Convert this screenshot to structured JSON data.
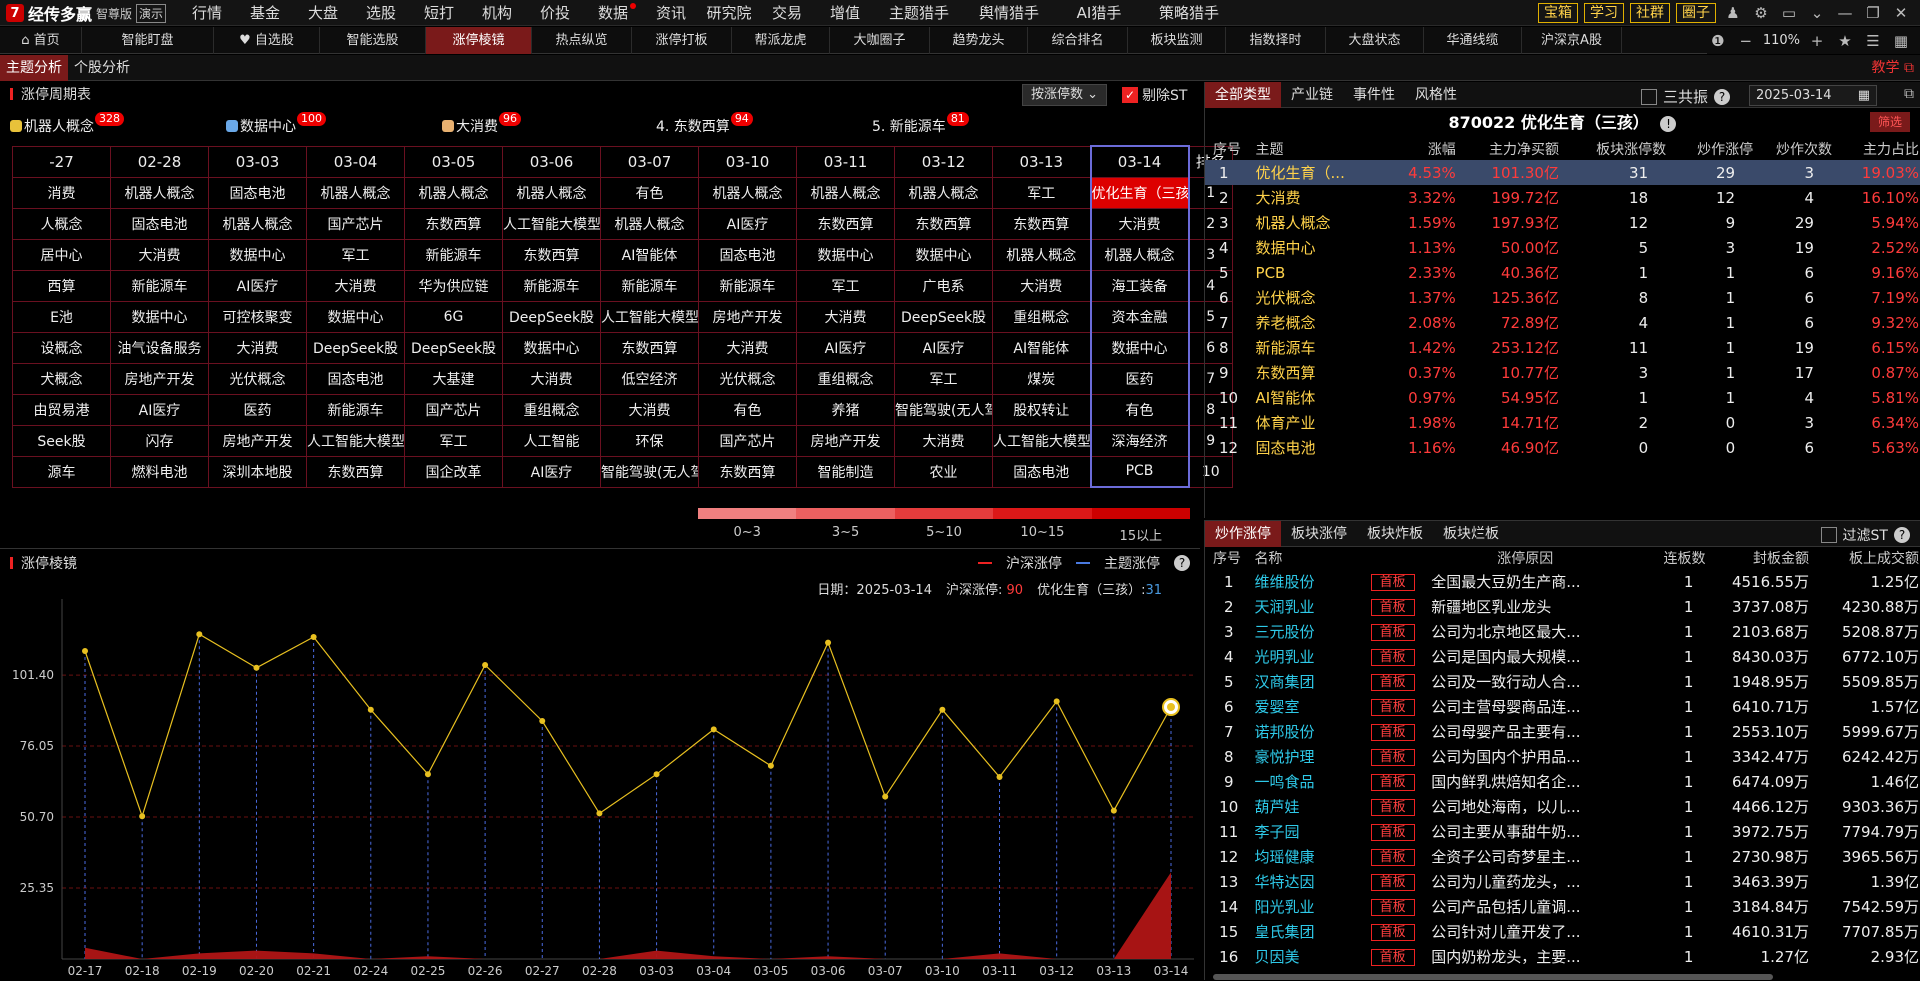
{
  "app": {
    "logo_mark": "7",
    "name": "经传多赢",
    "edition": "智尊版",
    "demo": "演示"
  },
  "top_menu": [
    {
      "label": "行情"
    },
    {
      "label": "基金"
    },
    {
      "label": "大盘"
    },
    {
      "label": "选股"
    },
    {
      "label": "短打"
    },
    {
      "label": "机构"
    },
    {
      "label": "价投"
    },
    {
      "label": "数据",
      "dot": true
    },
    {
      "label": "资讯"
    },
    {
      "label": "研究院"
    },
    {
      "label": "交易"
    },
    {
      "label": "增值"
    },
    {
      "label": "主题猎手",
      "wide": true
    },
    {
      "label": "舆情猎手",
      "wide": true
    },
    {
      "label": "AI猎手",
      "wide": true
    },
    {
      "label": "策略猎手",
      "wide": true
    }
  ],
  "top_right": {
    "buttons": [
      "宝箱",
      "学习",
      "社群",
      "圈子"
    ]
  },
  "tabs": [
    {
      "label": "⌂ 首页",
      "w": 82
    },
    {
      "label": "智能盯盘",
      "w": 132
    },
    {
      "label": "♥ 自选股",
      "w": 106
    },
    {
      "label": "智能选股",
      "w": 106
    },
    {
      "label": "涨停棱镜",
      "w": 106,
      "active": true
    },
    {
      "label": "热点纵览",
      "w": 100
    },
    {
      "label": "涨停打板",
      "w": 100
    },
    {
      "label": "帮派龙虎",
      "w": 98
    },
    {
      "label": "大咖圈子",
      "w": 100
    },
    {
      "label": "趋势龙头",
      "w": 98
    },
    {
      "label": "综合排名",
      "w": 100
    },
    {
      "label": "板块监测",
      "w": 98
    },
    {
      "label": "指数择时",
      "w": 100
    },
    {
      "label": "大盘状态",
      "w": 98
    },
    {
      "label": "华通线缆",
      "w": 98
    },
    {
      "label": "沪深京A股",
      "w": 100
    }
  ],
  "zoom": "110%",
  "sub_tabs": [
    {
      "label": "主题分析",
      "active": true
    },
    {
      "label": "个股分析"
    }
  ],
  "teach": "教学",
  "cycle": {
    "title": "涨停周期表",
    "sort_label": "按涨停数 ⌄",
    "exclude_st": "剔除ST",
    "legend": [
      {
        "label": "机器人概念",
        "count": "328",
        "color": "#e8c23a",
        "x": 0
      },
      {
        "label": "数据中心",
        "count": "100",
        "color": "#6aa8e8",
        "x": 216
      },
      {
        "label": "大消费",
        "count": "96",
        "color": "#e8b070",
        "x": 432
      },
      {
        "label": "4. 东数西算",
        "count": "94",
        "x": 646
      },
      {
        "label": "5. 新能源车",
        "count": "81",
        "x": 862
      }
    ],
    "dates": [
      "-27",
      "02-28",
      "03-03",
      "03-04",
      "03-05",
      "03-06",
      "03-07",
      "03-10",
      "03-11",
      "03-12",
      "03-13",
      "03-14"
    ],
    "rank_header": "排名",
    "rows": [
      [
        "消费",
        "机器人概念",
        "固态电池",
        "机器人概念",
        "机器人概念",
        "机器人概念",
        "有色",
        "机器人概念",
        "机器人概念",
        "机器人概念",
        "军工",
        "优化生育（三孩）",
        "1"
      ],
      [
        "人概念",
        "固态电池",
        "机器人概念",
        "国产芯片",
        "东数西算",
        "人工智能大模型",
        "机器人概念",
        "AI医疗",
        "东数西算",
        "东数西算",
        "东数西算",
        "大消费",
        "2"
      ],
      [
        "居中心",
        "大消费",
        "数据中心",
        "军工",
        "新能源车",
        "东数西算",
        "AI智能体",
        "固态电池",
        "数据中心",
        "数据中心",
        "机器人概念",
        "机器人概念",
        "3"
      ],
      [
        "西算",
        "新能源车",
        "AI医疗",
        "大消费",
        "华为供应链",
        "新能源车",
        "新能源车",
        "新能源车",
        "军工",
        "广电系",
        "大消费",
        "海工装备",
        "4"
      ],
      [
        "E池",
        "数据中心",
        "可控核聚变",
        "数据中心",
        "6G",
        "DeepSeek股",
        "人工智能大模型",
        "房地产开发",
        "大消费",
        "DeepSeek股",
        "重组概念",
        "资本金融",
        "5"
      ],
      [
        "设概念",
        "油气设备服务",
        "大消费",
        "DeepSeek股",
        "DeepSeek股",
        "数据中心",
        "东数西算",
        "大消费",
        "AI医疗",
        "AI医疗",
        "AI智能体",
        "数据中心",
        "6"
      ],
      [
        "犬概念",
        "房地产开发",
        "光伏概念",
        "固态电池",
        "大基建",
        "大消费",
        "低空经济",
        "光伏概念",
        "重组概念",
        "军工",
        "煤炭",
        "医药",
        "7"
      ],
      [
        "由贸易港",
        "AI医疗",
        "医药",
        "新能源车",
        "国产芯片",
        "重组概念",
        "大消费",
        "有色",
        "养猪",
        "智能驾驶(无人驾驶)",
        "股权转让",
        "有色",
        "8"
      ],
      [
        "Seek股",
        "闪存",
        "房地产开发",
        "人工智能大模型",
        "军工",
        "人工智能",
        "环保",
        "国产芯片",
        "房地产开发",
        "大消费",
        "人工智能大模型",
        "深海经济",
        "9"
      ],
      [
        "源车",
        "燃料电池",
        "深圳本地股",
        "东数西算",
        "国企改革",
        "AI医疗",
        "智能驾驶(无人驾驶)",
        "东数西算",
        "智能制造",
        "农业",
        "固态电池",
        "PCB",
        "10"
      ]
    ],
    "heat_colors": [
      "#f08080",
      "#ec6060",
      "#e43c3c",
      "#dc1818",
      "#cc0000"
    ],
    "heat_labels": [
      "0~3",
      "3~5",
      "5~10",
      "10~15",
      "15以上"
    ]
  },
  "prism": {
    "title": "涨停棱镜",
    "legend_sh": "沪深涨停",
    "legend_theme": "主题涨停",
    "info": {
      "date_label": "日期：",
      "date": "2025-03-14",
      "sh_label": "沪深涨停:",
      "sh_value": "90",
      "theme_label": "优化生育（三孩）:",
      "theme_value": "31"
    }
  },
  "chart_data": {
    "type": "line",
    "x": [
      "02-17",
      "02-18",
      "02-19",
      "02-20",
      "02-21",
      "02-24",
      "02-25",
      "02-26",
      "02-27",
      "02-28",
      "03-03",
      "03-04",
      "03-05",
      "03-06",
      "03-07",
      "03-10",
      "03-11",
      "03-12",
      "03-13",
      "03-14"
    ],
    "yticks": [
      25.35,
      50.7,
      76.05,
      101.4
    ],
    "ylim": [
      0,
      125
    ],
    "series": [
      {
        "name": "沪深涨停",
        "type": "area",
        "values": [
          110,
          51,
          116,
          104,
          115,
          89,
          66,
          105,
          85,
          52,
          66,
          82,
          69,
          113,
          58,
          89,
          65,
          92,
          53,
          90
        ]
      },
      {
        "name": "主题涨停",
        "type": "area",
        "values": [
          4,
          0,
          2,
          3,
          2,
          0,
          1,
          0,
          0,
          0,
          3,
          1,
          0,
          1,
          0,
          0,
          2,
          0,
          0,
          31
        ]
      }
    ]
  },
  "right": {
    "tabs": [
      {
        "label": "全部类型",
        "active": true
      },
      {
        "label": "产业链"
      },
      {
        "label": "事件性"
      },
      {
        "label": "风格性"
      }
    ],
    "sangong": "三共振",
    "date": "2025-03-14",
    "stock_title": "870022 优化生育（三孩）",
    "filter": "筛选",
    "headers": [
      "序号",
      "主题",
      "涨幅",
      "主力净买额",
      "板块涨停数",
      "炒作涨停",
      "炒作次数",
      "主力占比"
    ],
    "rows": [
      [
        "1",
        "优化生育（...",
        "4.53%",
        "101.30亿",
        "31",
        "29",
        "3",
        "19.03%"
      ],
      [
        "2",
        "大消费",
        "3.32%",
        "199.72亿",
        "18",
        "12",
        "4",
        "16.10%"
      ],
      [
        "3",
        "机器人概念",
        "1.59%",
        "197.93亿",
        "12",
        "9",
        "29",
        "5.94%"
      ],
      [
        "4",
        "数据中心",
        "1.13%",
        "50.00亿",
        "5",
        "3",
        "19",
        "2.52%"
      ],
      [
        "5",
        "PCB",
        "2.33%",
        "40.36亿",
        "1",
        "1",
        "6",
        "9.16%"
      ],
      [
        "6",
        "光伏概念",
        "1.37%",
        "125.36亿",
        "8",
        "1",
        "6",
        "7.19%"
      ],
      [
        "7",
        "养老概念",
        "2.08%",
        "72.89亿",
        "4",
        "1",
        "6",
        "9.32%"
      ],
      [
        "8",
        "新能源车",
        "1.42%",
        "253.12亿",
        "11",
        "1",
        "19",
        "6.15%"
      ],
      [
        "9",
        "东数西算",
        "0.37%",
        "10.77亿",
        "3",
        "1",
        "17",
        "0.87%"
      ],
      [
        "10",
        "AI智能体",
        "0.97%",
        "54.95亿",
        "1",
        "1",
        "4",
        "5.81%"
      ],
      [
        "11",
        "体育产业",
        "1.98%",
        "14.71亿",
        "2",
        "0",
        "3",
        "6.34%"
      ],
      [
        "12",
        "固态电池",
        "1.16%",
        "46.90亿",
        "0",
        "0",
        "6",
        "5.63%"
      ]
    ],
    "bottom_tabs": [
      {
        "label": "炒作涨停",
        "active": true
      },
      {
        "label": "板块涨停"
      },
      {
        "label": "板块炸板"
      },
      {
        "label": "板块烂板"
      }
    ],
    "filter_st": "过滤ST",
    "stock_headers": [
      "序号",
      "名称",
      "",
      "涨停原因",
      "连板数",
      "封板金额",
      "板上成交额"
    ],
    "stocks": [
      [
        "1",
        "维维股份",
        "首板",
        "全国最大豆奶生产商...",
        "1",
        "4516.55万",
        "1.25亿"
      ],
      [
        "2",
        "天润乳业",
        "首板",
        "新疆地区乳业龙头",
        "1",
        "3737.08万",
        "4230.88万"
      ],
      [
        "3",
        "三元股份",
        "首板",
        "公司为北京地区最大...",
        "1",
        "2103.68万",
        "5208.87万"
      ],
      [
        "4",
        "光明乳业",
        "首板",
        "公司是国内最大规模...",
        "1",
        "8430.03万",
        "6772.10万"
      ],
      [
        "5",
        "汉商集团",
        "首板",
        "公司及一致行动人合...",
        "1",
        "1948.95万",
        "5509.85万"
      ],
      [
        "6",
        "爱婴室",
        "首板",
        "公司主营母婴商品连...",
        "1",
        "6410.71万",
        "1.57亿"
      ],
      [
        "7",
        "诺邦股份",
        "首板",
        "公司母婴产品主要有...",
        "1",
        "2553.10万",
        "5999.67万"
      ],
      [
        "8",
        "豪悦护理",
        "首板",
        "公司为国内个护用品...",
        "1",
        "3342.47万",
        "6242.42万"
      ],
      [
        "9",
        "一鸣食品",
        "首板",
        "国内鲜乳烘焙知名企...",
        "1",
        "6474.09万",
        "1.46亿"
      ],
      [
        "10",
        "葫芦娃",
        "首板",
        "公司地处海南，以儿...",
        "1",
        "4466.12万",
        "9303.36万"
      ],
      [
        "11",
        "李子园",
        "首板",
        "公司主要从事甜牛奶...",
        "1",
        "3972.75万",
        "7794.79万"
      ],
      [
        "12",
        "均瑶健康",
        "首板",
        "全资子公司奇梦星主...",
        "1",
        "2730.98万",
        "3965.56万"
      ],
      [
        "13",
        "华特达因",
        "首板",
        "公司为儿童药龙头，...",
        "1",
        "3463.39万",
        "1.39亿"
      ],
      [
        "14",
        "阳光乳业",
        "首板",
        "公司产品包括儿童调...",
        "1",
        "3184.84万",
        "7542.59万"
      ],
      [
        "15",
        "皇氏集团",
        "首板",
        "公司针对儿童开发了...",
        "1",
        "4610.31万",
        "7707.85万"
      ],
      [
        "16",
        "贝因美",
        "首板",
        "国内奶粉龙头，主要...",
        "1",
        "1.27亿",
        "2.93亿"
      ]
    ]
  }
}
